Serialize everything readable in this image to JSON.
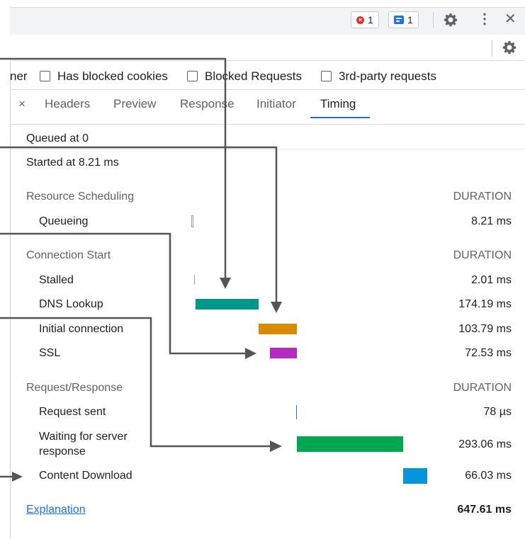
{
  "header": {
    "error_count": "1",
    "message_count": "1"
  },
  "filters": {
    "partial_label": "ner",
    "items": [
      {
        "label": "Has blocked cookies",
        "checked": false
      },
      {
        "label": "Blocked Requests",
        "checked": false
      },
      {
        "label": "3rd-party requests",
        "checked": false
      }
    ]
  },
  "tabs": {
    "close": "×",
    "items": [
      "Headers",
      "Preview",
      "Response",
      "Initiator",
      "Timing"
    ],
    "active": "Timing"
  },
  "timing": {
    "queued_at": "Queued at 0",
    "started_at": "Started at 8.21 ms",
    "duration_header": "DURATION",
    "sections": [
      {
        "title": "Resource Scheduling",
        "rows": [
          {
            "label": "Queueing",
            "value": "8.21 ms",
            "color": "#ffffff",
            "start_ms": 0,
            "duration_ms": 8.21
          }
        ]
      },
      {
        "title": "Connection Start",
        "rows": [
          {
            "label": "Stalled",
            "value": "2.01 ms",
            "color": "#bdbdbd",
            "start_ms": 8.21,
            "duration_ms": 2.01
          },
          {
            "label": "DNS Lookup",
            "value": "174.19 ms",
            "color": "#009688",
            "start_ms": 10.22,
            "duration_ms": 174.19
          },
          {
            "label": "Initial connection",
            "value": "103.79 ms",
            "color": "#d98b00",
            "start_ms": 184.41,
            "duration_ms": 103.79
          },
          {
            "label": "SSL",
            "value": "72.53 ms",
            "color": "#b52ac2",
            "start_ms": 215.67,
            "duration_ms": 72.53
          }
        ]
      },
      {
        "title": "Request/Response",
        "rows": [
          {
            "label": "Request sent",
            "value": "78 µs",
            "color": "#2a7fb8",
            "start_ms": 288.2,
            "duration_ms": 0.078
          },
          {
            "label": "Waiting for server",
            "label2": "response",
            "value": "293.06 ms",
            "color": "#00a650",
            "start_ms": 288.3,
            "duration_ms": 293.06
          },
          {
            "label": "Content Download",
            "value": "66.03 ms",
            "color": "#0395de",
            "start_ms": 581.4,
            "duration_ms": 66.03
          }
        ]
      }
    ],
    "explanation_link": "Explanation",
    "total": "647.61 ms"
  },
  "colors": {
    "accent": "#1a73e8",
    "arrow": "#555555"
  }
}
